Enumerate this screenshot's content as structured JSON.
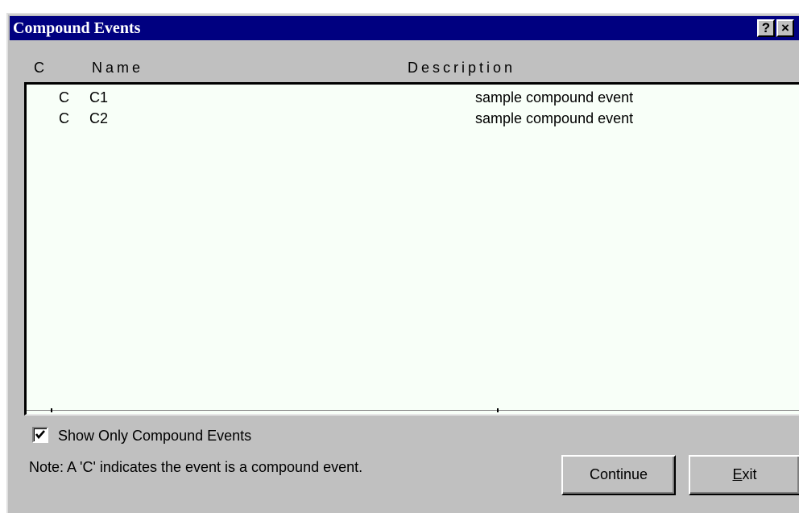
{
  "window": {
    "title": "Compound Events",
    "help_label": "?",
    "close_label": "×"
  },
  "columns": {
    "c": "C",
    "name": "Name",
    "description": "Description"
  },
  "rows": [
    {
      "c": "C",
      "name": "C1",
      "description": "sample compound event"
    },
    {
      "c": "C",
      "name": "C2",
      "description": "sample compound event"
    }
  ],
  "show_only_compound": {
    "label": "Show Only Compound Events",
    "checked": true
  },
  "note": "Note:  A 'C' indicates the event is a compound event.",
  "buttons": {
    "continue_label": "Continue",
    "exit_underlined": "E",
    "exit_rest": "xit"
  },
  "colors": {
    "titlebar": "#000080",
    "dialog_face": "#c0c0c0",
    "list_background": "#f8fff8"
  }
}
